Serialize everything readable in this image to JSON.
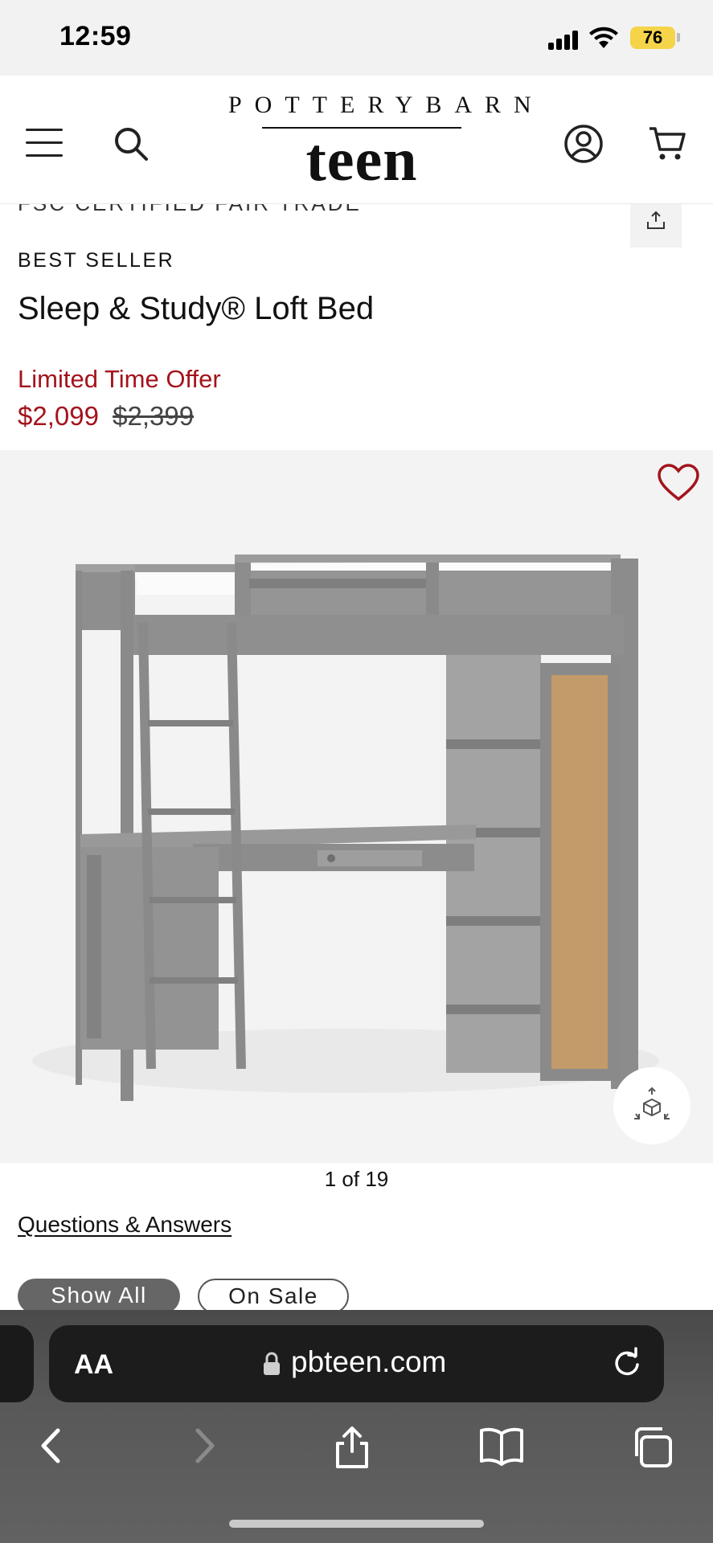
{
  "status_bar": {
    "time": "12:59",
    "battery": "76"
  },
  "header": {
    "logo_top": "POTTERYBARN",
    "logo_main": "teen"
  },
  "product": {
    "scrolled_text": "FSC CERTIFIED   FAIR TRADE",
    "badge": "BEST SELLER",
    "title": "Sleep & Study® Loft Bed",
    "offer_label": "Limited Time Offer",
    "price_sale": "$2,099",
    "price_original": "$2,399",
    "image_counter": "1 of 19"
  },
  "links": {
    "qa": "Questions & Answers"
  },
  "filters": {
    "show_all": "Show All",
    "on_sale": "On Sale"
  },
  "browser": {
    "aa": "AA",
    "url": "pbteen.com"
  },
  "colors": {
    "sale_red": "#a3141c",
    "heart": "#a3141c",
    "browser_bg": "#565656"
  },
  "icons": [
    "menu-icon",
    "search-icon",
    "account-icon",
    "cart-icon",
    "share-icon",
    "heart-icon",
    "ar-view-icon",
    "lock-icon",
    "reload-icon",
    "back-icon",
    "forward-icon",
    "share-icon",
    "bookmarks-icon",
    "tabs-icon"
  ]
}
